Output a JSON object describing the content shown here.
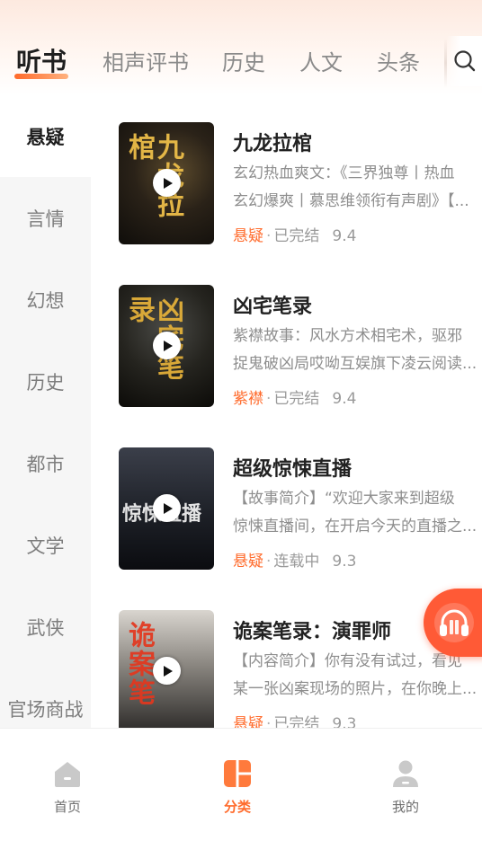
{
  "top_tabs": {
    "items": [
      {
        "label": "听书",
        "active": true
      },
      {
        "label": "相声评书"
      },
      {
        "label": "历史"
      },
      {
        "label": "人文"
      },
      {
        "label": "头条"
      }
    ],
    "search_icon": "search-icon"
  },
  "sidebar": {
    "items": [
      {
        "label": "悬疑",
        "active": true
      },
      {
        "label": "言情"
      },
      {
        "label": "幻想"
      },
      {
        "label": "历史"
      },
      {
        "label": "都市"
      },
      {
        "label": "文学"
      },
      {
        "label": "武侠"
      },
      {
        "label": "官场商战"
      }
    ]
  },
  "books": [
    {
      "title": "九龙拉棺",
      "desc_line1": "玄幻热血爽文：《三界独尊丨热血",
      "desc_line2": "玄幻爆爽丨慕思维领衔有声剧》【...",
      "tag": "悬疑",
      "status": "已完结",
      "score": "9.4",
      "cover_text": "九龙拉棺"
    },
    {
      "title": "凶宅笔录",
      "desc_line1": "紫襟故事：风水方术相宅术，驱邪",
      "desc_line2": "捉鬼破凶局哎呦互娱旗下凌云阅读...",
      "tag": "紫襟",
      "status": "已完结",
      "score": "9.4",
      "cover_text": "凶宅笔录"
    },
    {
      "title": "超级惊悚直播",
      "desc_line1": "【故事简介】“欢迎大家来到超级",
      "desc_line2": "惊悚直播间，在开启今天的直播之...",
      "tag": "悬疑",
      "status": "连载中",
      "score": "9.3",
      "cover_text": "惊悚直播"
    },
    {
      "title": "诡案笔录：演罪师",
      "desc_line1": "【内容简介】你有没有试过，看见",
      "desc_line2": "某一张凶案现场的照片，在你晚上...",
      "tag": "悬疑",
      "status": "已完结",
      "score": "9.3",
      "cover_text": "诡案笔"
    }
  ],
  "floating_player": {
    "icon": "headphones-icon"
  },
  "bottom_nav": {
    "items": [
      {
        "label": "首页",
        "icon": "home-icon"
      },
      {
        "label": "分类",
        "icon": "category-icon",
        "active": true
      },
      {
        "label": "我的",
        "icon": "profile-icon"
      }
    ]
  },
  "colors": {
    "accent": "#ff6b2c",
    "float_player": "#ff5a36",
    "sidebar_bg": "#f6f6f6"
  }
}
